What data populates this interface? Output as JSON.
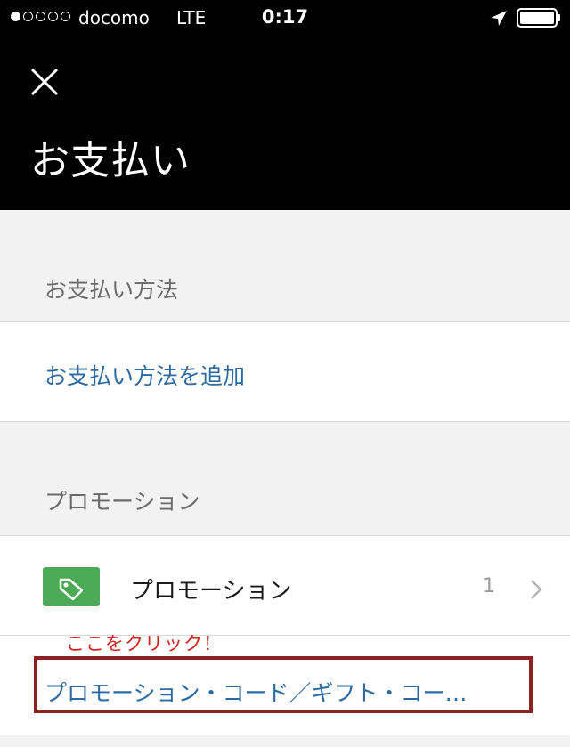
{
  "status_bar": {
    "carrier": "docomo",
    "network": "LTE",
    "time": "0:17"
  },
  "header": {
    "title": "お支払い"
  },
  "payment_section": {
    "label": "お支払い方法",
    "add_link": "お支払い方法を追加"
  },
  "promotion_section": {
    "label": "プロモーション",
    "row_label": "プロモーション",
    "count": "1",
    "code_link": "プロモーション・コード／ギフト・コー…"
  },
  "annotation": {
    "text": "ここをクリック！"
  },
  "colors": {
    "link": "#2d6a9f",
    "tag_icon_bg": "#4caa57",
    "annotation_text": "#d0261e",
    "annotation_box": "#8b2323"
  }
}
